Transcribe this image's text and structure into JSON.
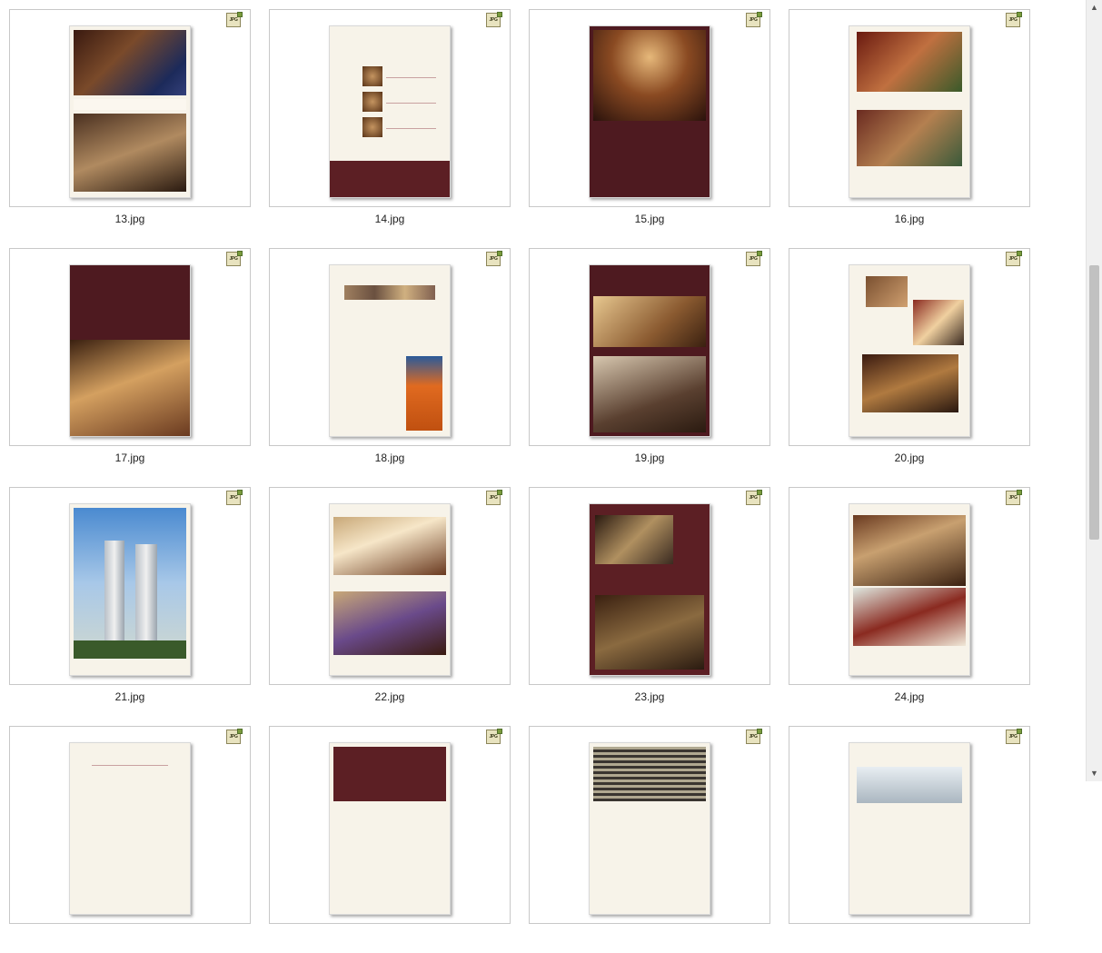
{
  "badge_label": "JPG",
  "scrollbar": {
    "up_icon": "▲",
    "down_icon": "▼"
  },
  "files": [
    {
      "name": "13.jpg",
      "style": "bedroom"
    },
    {
      "name": "14.jpg",
      "style": "honor"
    },
    {
      "name": "15.jpg",
      "style": "darkroom"
    },
    {
      "name": "16.jpg",
      "style": "restaurant"
    },
    {
      "name": "17.jpg",
      "style": "process"
    },
    {
      "name": "18.jpg",
      "style": "worker"
    },
    {
      "name": "19.jpg",
      "style": "lobby"
    },
    {
      "name": "20.jpg",
      "style": "dining"
    },
    {
      "name": "21.jpg",
      "style": "towers"
    },
    {
      "name": "22.jpg",
      "style": "hall"
    },
    {
      "name": "23.jpg",
      "style": "maroon"
    },
    {
      "name": "24.jpg",
      "style": "banquet"
    },
    {
      "name": "",
      "style": "decoration"
    },
    {
      "name": "",
      "style": "chinese"
    },
    {
      "name": "",
      "style": "ceiling"
    },
    {
      "name": "",
      "style": "bright"
    }
  ]
}
